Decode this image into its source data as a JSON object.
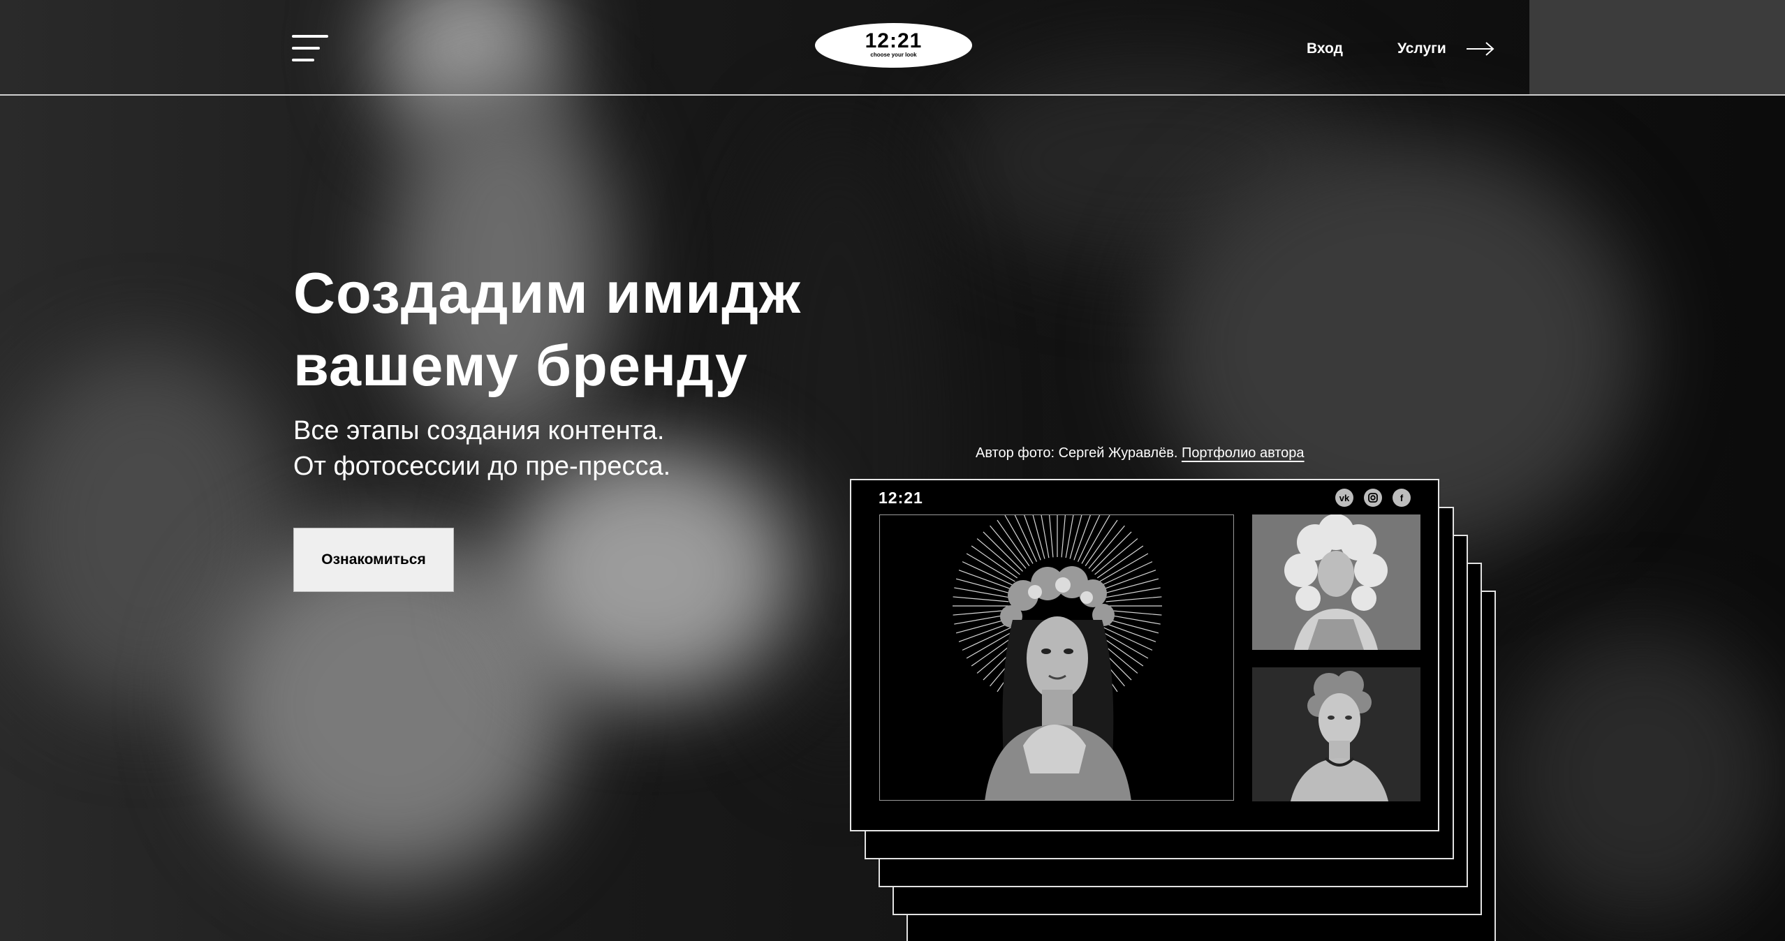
{
  "header": {
    "logo_time": "12:21",
    "logo_subtitle": "choose your look",
    "nav_login": "Вход",
    "nav_services": "Услуги"
  },
  "hero": {
    "title_line1": "Создадим имидж",
    "title_line2": "вашему бренду",
    "subtitle_line1": "Все этапы создания контента.",
    "subtitle_line2": "От фотосессии до пре-пресса.",
    "cta_label": "Ознакомиться"
  },
  "credit": {
    "text": "Автор фото: Сергей Журавлёв.",
    "link": "Портфолио автора"
  },
  "card": {
    "logo": "12:21",
    "social_icons": [
      "vk-icon",
      "instagram-icon",
      "facebook-icon"
    ]
  },
  "colors": {
    "background": "#0d0d0d",
    "text": "#ffffff",
    "button_bg": "#efefef"
  }
}
